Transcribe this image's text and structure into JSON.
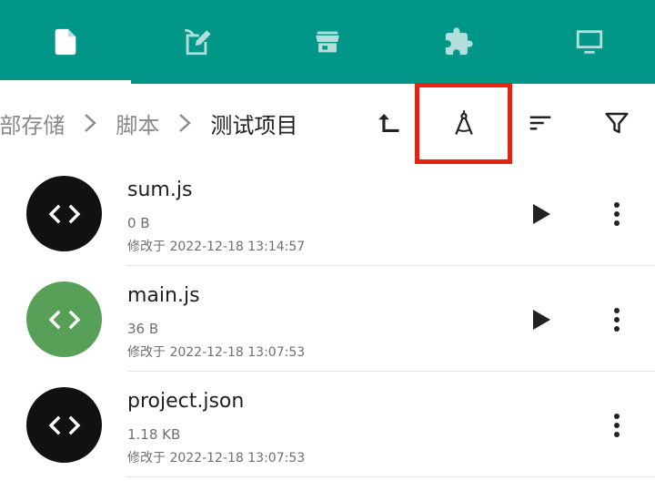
{
  "tabs": [
    {
      "icon": "file-icon"
    },
    {
      "icon": "edit-document-icon"
    },
    {
      "icon": "store-icon"
    },
    {
      "icon": "extension-icon"
    },
    {
      "icon": "monitor-icon"
    }
  ],
  "colors": {
    "primary": "#009688",
    "avatar_dark": "#111111",
    "avatar_green": "#58a058",
    "highlight": "#e8220f"
  },
  "breadcrumb": {
    "items": [
      "内部存储",
      "脚本",
      "测试项目"
    ],
    "visible": [
      "]部存储",
      "脚本",
      "测试项目"
    ]
  },
  "toolbar": {
    "icons": [
      "go-up-icon",
      "build-compass-icon",
      "sort-icon",
      "filter-icon"
    ]
  },
  "files": [
    {
      "name": "sum.js",
      "size": "0 B",
      "modified": "修改于 2022-12-18 13:14:57",
      "runnable": true,
      "avatar_color": "#111111"
    },
    {
      "name": "main.js",
      "size": "36 B",
      "modified": "修改于 2022-12-18 13:07:53",
      "runnable": true,
      "avatar_color": "#58a058"
    },
    {
      "name": "project.json",
      "size": "1.18 KB",
      "modified": "修改于 2022-12-18 13:07:53",
      "runnable": false,
      "avatar_color": "#111111"
    }
  ]
}
